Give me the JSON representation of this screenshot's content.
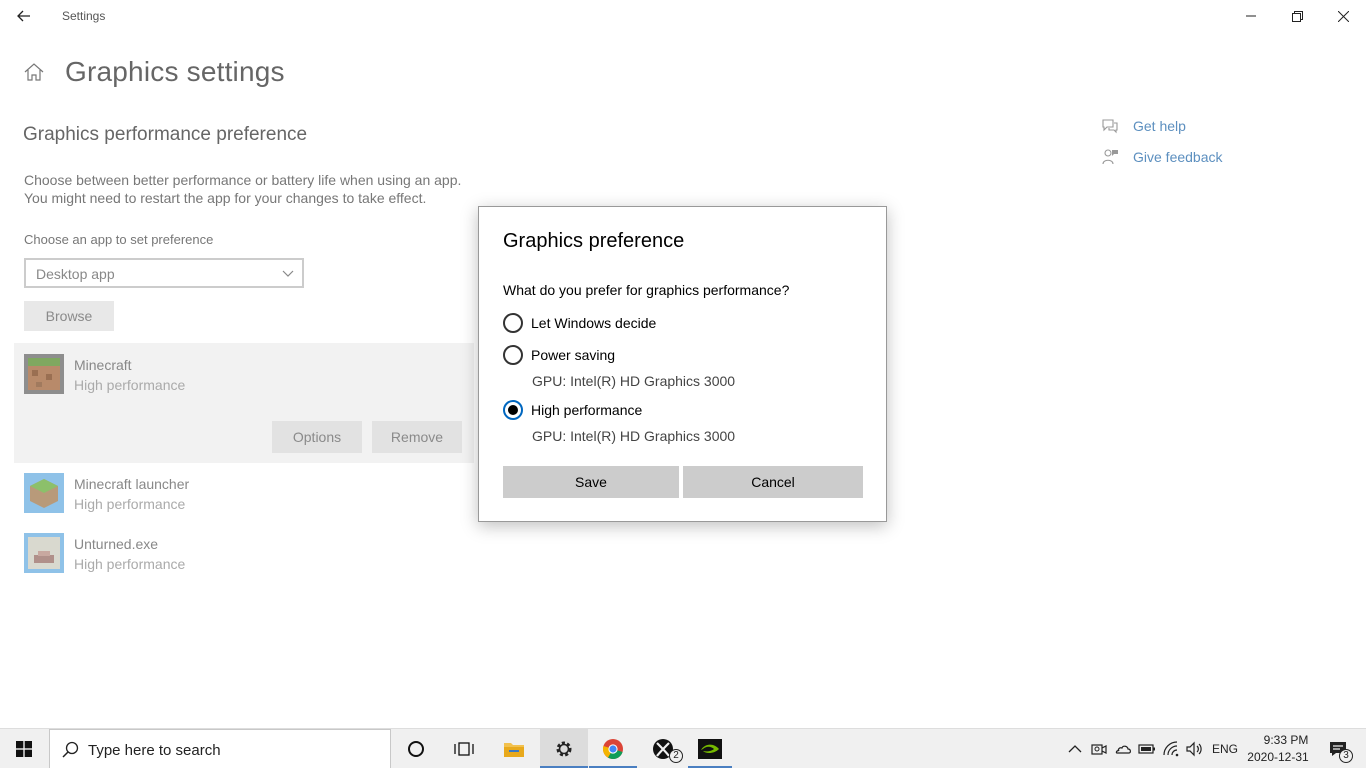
{
  "window": {
    "title": "Settings"
  },
  "page": {
    "title": "Graphics settings",
    "section_title": "Graphics performance preference",
    "description": "Choose between better performance or battery life when using an app. You might need to restart the app for your changes to take effect.",
    "choose_label": "Choose an app to set preference",
    "dropdown_value": "Desktop app",
    "browse_label": "Browse",
    "apps": [
      {
        "name": "Minecraft",
        "preference": "High performance"
      },
      {
        "name": "Minecraft launcher",
        "preference": "High performance"
      },
      {
        "name": "Unturned.exe",
        "preference": "High performance"
      }
    ],
    "options_label": "Options",
    "remove_label": "Remove",
    "help": {
      "get_help": "Get help",
      "give_feedback": "Give feedback"
    }
  },
  "dialog": {
    "title": "Graphics preference",
    "question": "What do you prefer for graphics performance?",
    "options": [
      {
        "label": "Let Windows decide",
        "gpu": "",
        "checked": false
      },
      {
        "label": "Power saving",
        "gpu": "GPU: Intel(R) HD Graphics 3000",
        "checked": false
      },
      {
        "label": "High performance",
        "gpu": "GPU: Intel(R) HD Graphics 3000",
        "checked": true
      }
    ],
    "save_label": "Save",
    "cancel_label": "Cancel",
    "accent_color": "#0067c0"
  },
  "taskbar": {
    "search_placeholder": "Type here to search",
    "xbox_badge": "2",
    "language": "ENG",
    "time": "9:33 PM",
    "date": "2020-12-31",
    "notification_badge": "3"
  }
}
